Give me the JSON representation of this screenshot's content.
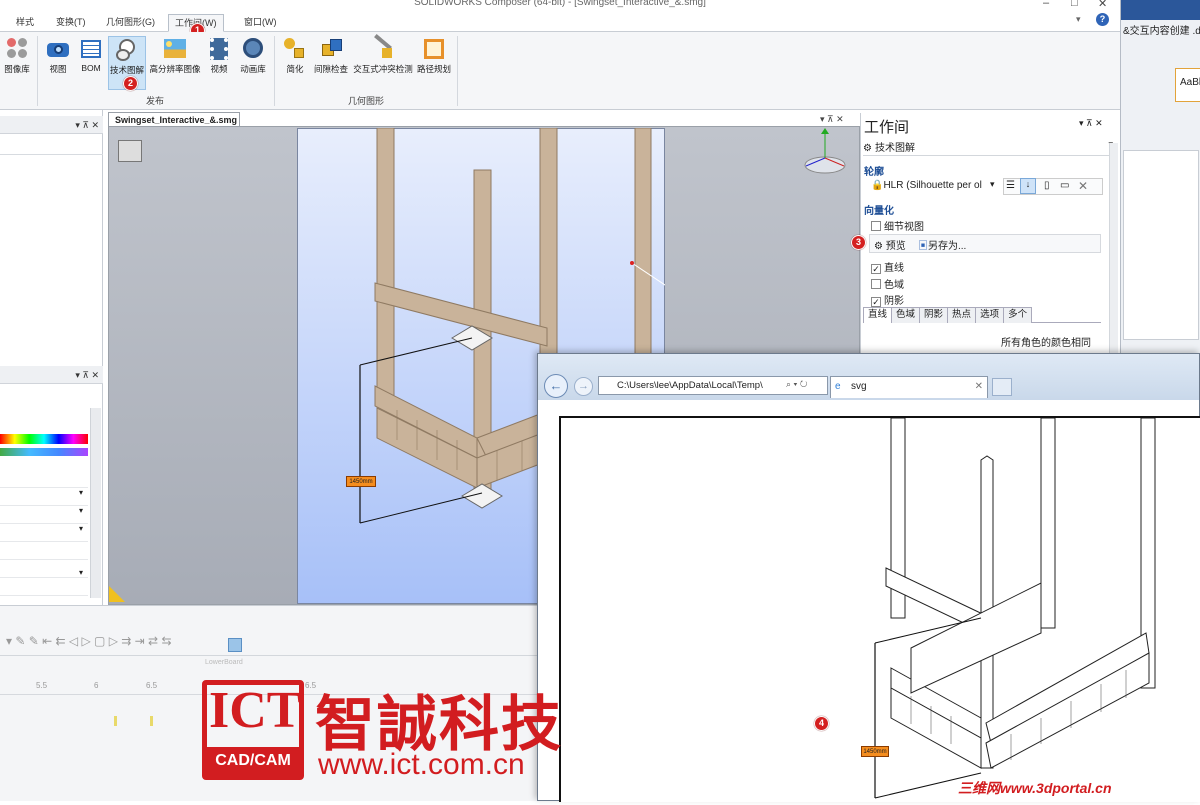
{
  "app": {
    "title": "SOLIDWORKS Composer (64-bit) - [Swingset_Interactive_&.smg]"
  },
  "menu_tabs": [
    "样式",
    "变换(T)",
    "几何图形(G)",
    "工作间(W)",
    "窗口(W)"
  ],
  "ribbon": {
    "buttons": [
      {
        "label": "图像库"
      },
      {
        "label": "视图"
      },
      {
        "label": "BOM"
      },
      {
        "label": "技术图解"
      },
      {
        "label": "高分辨率图像"
      },
      {
        "label": "视频"
      },
      {
        "label": "动画库"
      },
      {
        "label": "简化"
      },
      {
        "label": "间隙检查"
      },
      {
        "label": "交互式冲突检测"
      },
      {
        "label": "路径规划"
      }
    ],
    "group_publish": "发布",
    "group_geometry": "几何图形"
  },
  "document": {
    "tab_label": "Swingset_Interactive_&.smg",
    "dimension_label": "1450mm"
  },
  "workshop": {
    "title": "工作间",
    "mode": "技术图解",
    "profile_section": "轮廓",
    "profile_value": "HLR (Silhouette per ol",
    "vectorize_section": "向量化",
    "detail_view": "细节视图",
    "preview_button": "预览",
    "save_as_button": "另存为...",
    "checks": [
      {
        "label": "直线",
        "checked": true
      },
      {
        "label": "色域",
        "checked": false
      },
      {
        "label": "阴影",
        "checked": true
      }
    ],
    "subtabs": [
      "直线",
      "色域",
      "阴影",
      "热点",
      "选项",
      "多个"
    ],
    "same_color_text": "所有角色的颜色相同"
  },
  "browser": {
    "address": "C:\\Users\\lee\\AppData\\Local\\Temp\\",
    "tab_title": "svg",
    "dimension_label": "1450mm"
  },
  "background_doc": {
    "title": "&交互内容创建 .do",
    "style_sample": "AaBl"
  },
  "timeline": {
    "ticks": [
      "5.5",
      "6",
      "6.5",
      "6.5"
    ],
    "track_label": "LowerBoard"
  },
  "steps": [
    "1",
    "2",
    "3",
    "4"
  ],
  "watermark": {
    "logo_text": "ICT",
    "logo_sub": "CAD/CAM",
    "company": "智誠科技",
    "url": "www.ict.com.cn",
    "portal": "三维网www.3dportal.cn"
  },
  "colors": {
    "accent_red": "#d21d20",
    "selection_blue": "#cde4f7",
    "section_blue": "#1f4f96"
  }
}
